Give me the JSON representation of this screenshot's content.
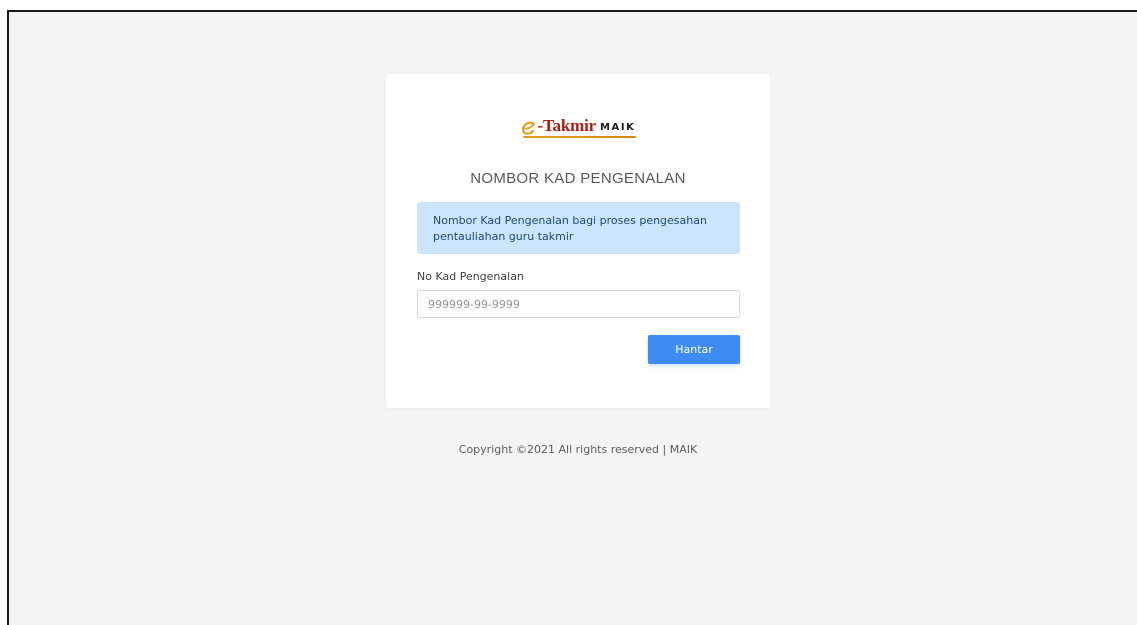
{
  "brand": {
    "name": "Takmir",
    "prefix": "-",
    "suffix": "MAIK",
    "accent_color": "#b01c12",
    "underline_color": "#e3a21a"
  },
  "form": {
    "title": "NOMBOR KAD PENGENALAN",
    "info_message": "Nombor Kad Pengenalan bagi proses pengesahan pentauliahan guru takmir",
    "id_label": "No Kad Pengenalan",
    "id_placeholder": "999999-99-9999",
    "id_value": "",
    "submit_label": "Hantar",
    "submit_color": "#3d8cf5",
    "alert_color": "#cce5ff"
  },
  "footer": {
    "copyright": "Copyright ©2021 All rights reserved | MAIK"
  }
}
